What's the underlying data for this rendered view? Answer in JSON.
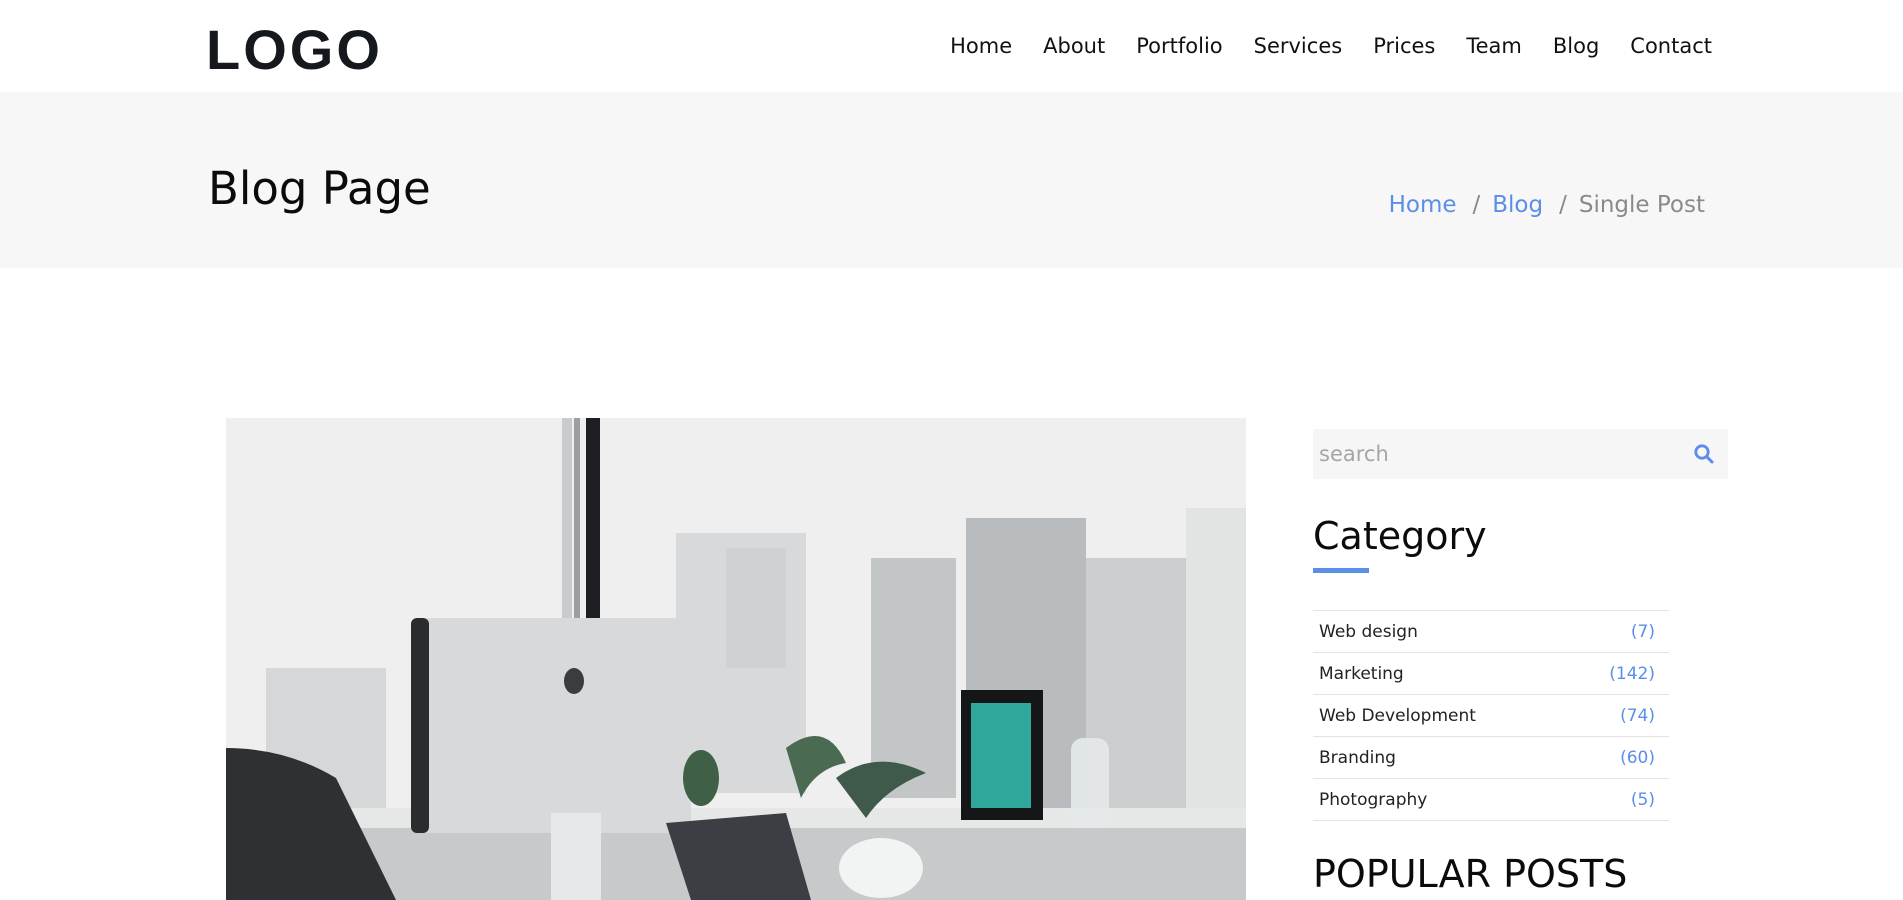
{
  "header": {
    "logo": "LOGO",
    "nav": [
      "Home",
      "About",
      "Portfolio",
      "Services",
      "Prices",
      "Team",
      "Blog",
      "Contact"
    ]
  },
  "banner": {
    "title": "Blog Page",
    "breadcrumb": [
      "Home",
      "Blog",
      "Single Post"
    ],
    "separator": "/"
  },
  "search": {
    "placeholder": "search",
    "icon": "search-icon"
  },
  "sidebar": {
    "category_title": "Category",
    "categories": [
      {
        "name": "Web design",
        "count": "(7)"
      },
      {
        "name": "Marketing",
        "count": "(142)"
      },
      {
        "name": "Web Development",
        "count": "(74)"
      },
      {
        "name": "Branding",
        "count": "(60)"
      },
      {
        "name": "Photography",
        "count": "(5)"
      }
    ],
    "popular_title": "POPULAR POSTS"
  },
  "colors": {
    "accent": "#5b8ee8",
    "band": "#f7f7f7"
  }
}
